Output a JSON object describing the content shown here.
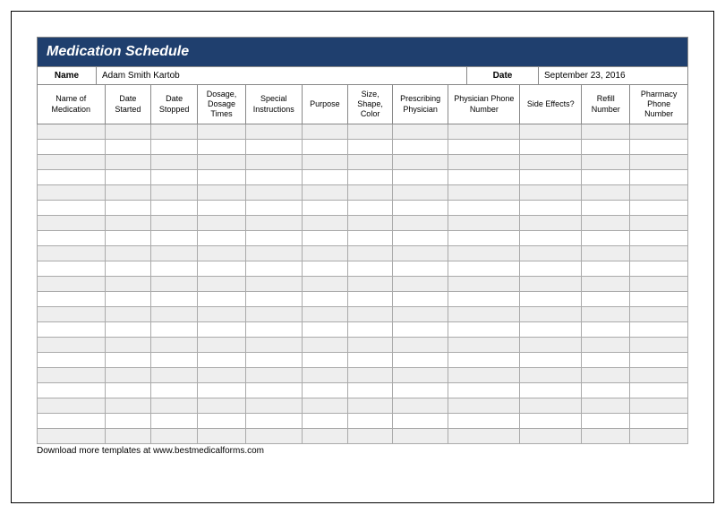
{
  "title": "Medication Schedule",
  "name_label": "Name",
  "name_value": "Adam Smith Kartob",
  "date_label": "Date",
  "date_value": "September 23, 2016",
  "columns": [
    "Name of Medication",
    "Date Started",
    "Date Stopped",
    "Dosage, Dosage Times",
    "Special Instructions",
    "Purpose",
    "Size, Shape, Color",
    "Prescribing Physician",
    "Physician Phone Number",
    "Side Effects?",
    "Refill Number",
    "Pharmacy Phone Number"
  ],
  "row_count": 21,
  "footer": "Download more templates at www.bestmedicalforms.com"
}
